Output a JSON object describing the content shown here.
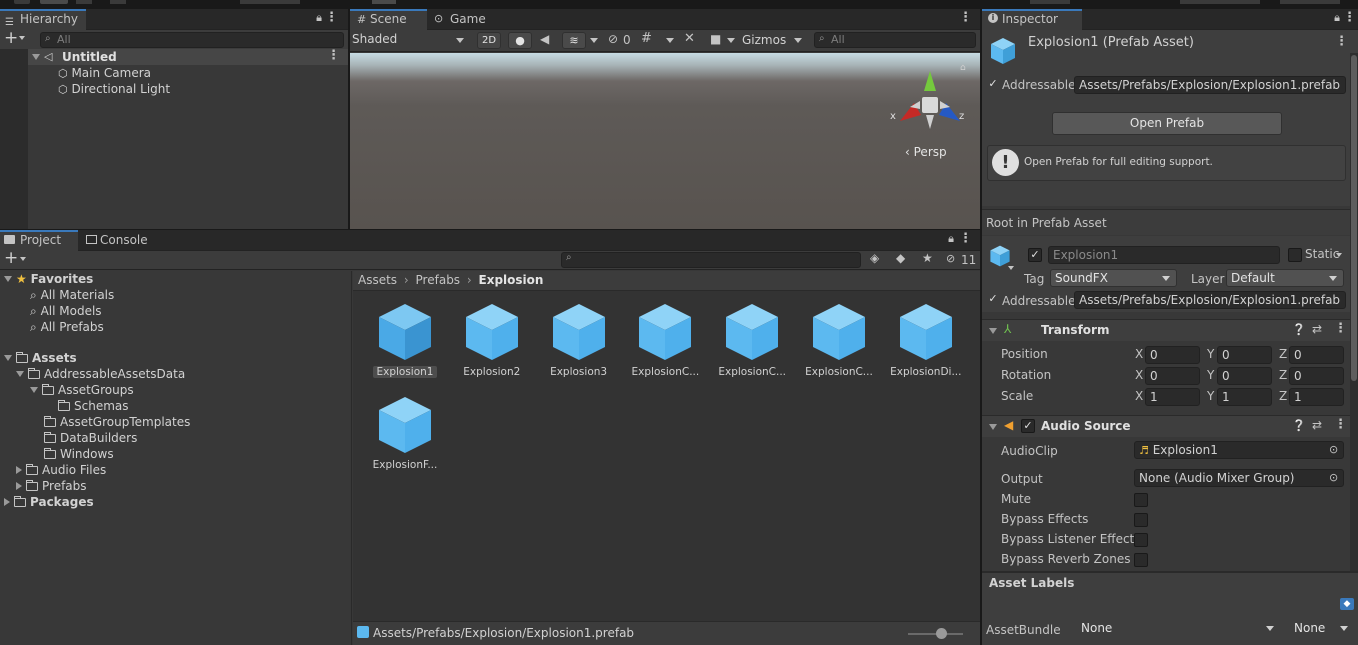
{
  "hierarchy": {
    "tab": "Hierarchy",
    "search_placeholder": "All",
    "scene_name": "Untitled",
    "items": [
      "Main Camera",
      "Directional Light"
    ]
  },
  "scene": {
    "tabs": [
      "Scene",
      "Game"
    ],
    "shading_mode": "Shaded",
    "mode_2d": "2D",
    "hidden_count": "0",
    "gizmos_label": "Gizmos",
    "search_placeholder": "All",
    "persp_label": "Persp",
    "axis_x": "x",
    "axis_z": "z"
  },
  "project": {
    "tabs": [
      "Project",
      "Console"
    ],
    "hidden_count": "11",
    "favorites_label": "Favorites",
    "favorites": [
      "All Materials",
      "All Models",
      "All Prefabs"
    ],
    "tree": {
      "assets": "Assets",
      "addressable_data": "AddressableAssetsData",
      "asset_groups": "AssetGroups",
      "schemas": "Schemas",
      "group_templates": "AssetGroupTemplates",
      "data_builders": "DataBuilders",
      "windows": "Windows",
      "audio_files": "Audio Files",
      "prefabs": "Prefabs",
      "packages": "Packages"
    },
    "breadcrumb": [
      "Assets",
      "Prefabs",
      "Explosion"
    ],
    "assets": [
      "Explosion1",
      "Explosion2",
      "Explosion3",
      "ExplosionC...",
      "ExplosionC...",
      "ExplosionC...",
      "ExplosionDi...",
      "ExplosionF..."
    ],
    "status_path": "Assets/Prefabs/Explosion/Explosion1.prefab",
    "zoom_level": 0.6
  },
  "inspector": {
    "tab": "Inspector",
    "title": "Explosion1 (Prefab Asset)",
    "addressable_label": "Addressable",
    "addressable_path": "Assets/Prefabs/Explosion/Explosion1.prefab",
    "open_prefab": "Open Prefab",
    "info_text": "Open Prefab for full editing support.",
    "root_label": "Root in Prefab Asset",
    "object_name": "Explosion1",
    "static_label": "Static",
    "tag_label": "Tag",
    "tag_value": "SoundFX",
    "layer_label": "Layer",
    "layer_value": "Default",
    "addressable_path2": "Assets/Prefabs/Explosion/Explosion1.prefab",
    "transform": {
      "title": "Transform",
      "rows": [
        {
          "label": "Position",
          "x": "0",
          "y": "0",
          "z": "0"
        },
        {
          "label": "Rotation",
          "x": "0",
          "y": "0",
          "z": "0"
        },
        {
          "label": "Scale",
          "x": "1",
          "y": "1",
          "z": "1"
        }
      ],
      "axis": [
        "X",
        "Y",
        "Z"
      ]
    },
    "audio": {
      "title": "Audio Source",
      "clip_label": "AudioClip",
      "clip_value": "Explosion1",
      "output_label": "Output",
      "output_value": "None (Audio Mixer Group)",
      "toggles": [
        "Mute",
        "Bypass Effects",
        "Bypass Listener Effects",
        "Bypass Reverb Zones"
      ]
    },
    "asset_labels": "Asset Labels",
    "assetbundle_label": "AssetBundle",
    "assetbundle_value": "None",
    "assetbundle_variant": "None"
  }
}
